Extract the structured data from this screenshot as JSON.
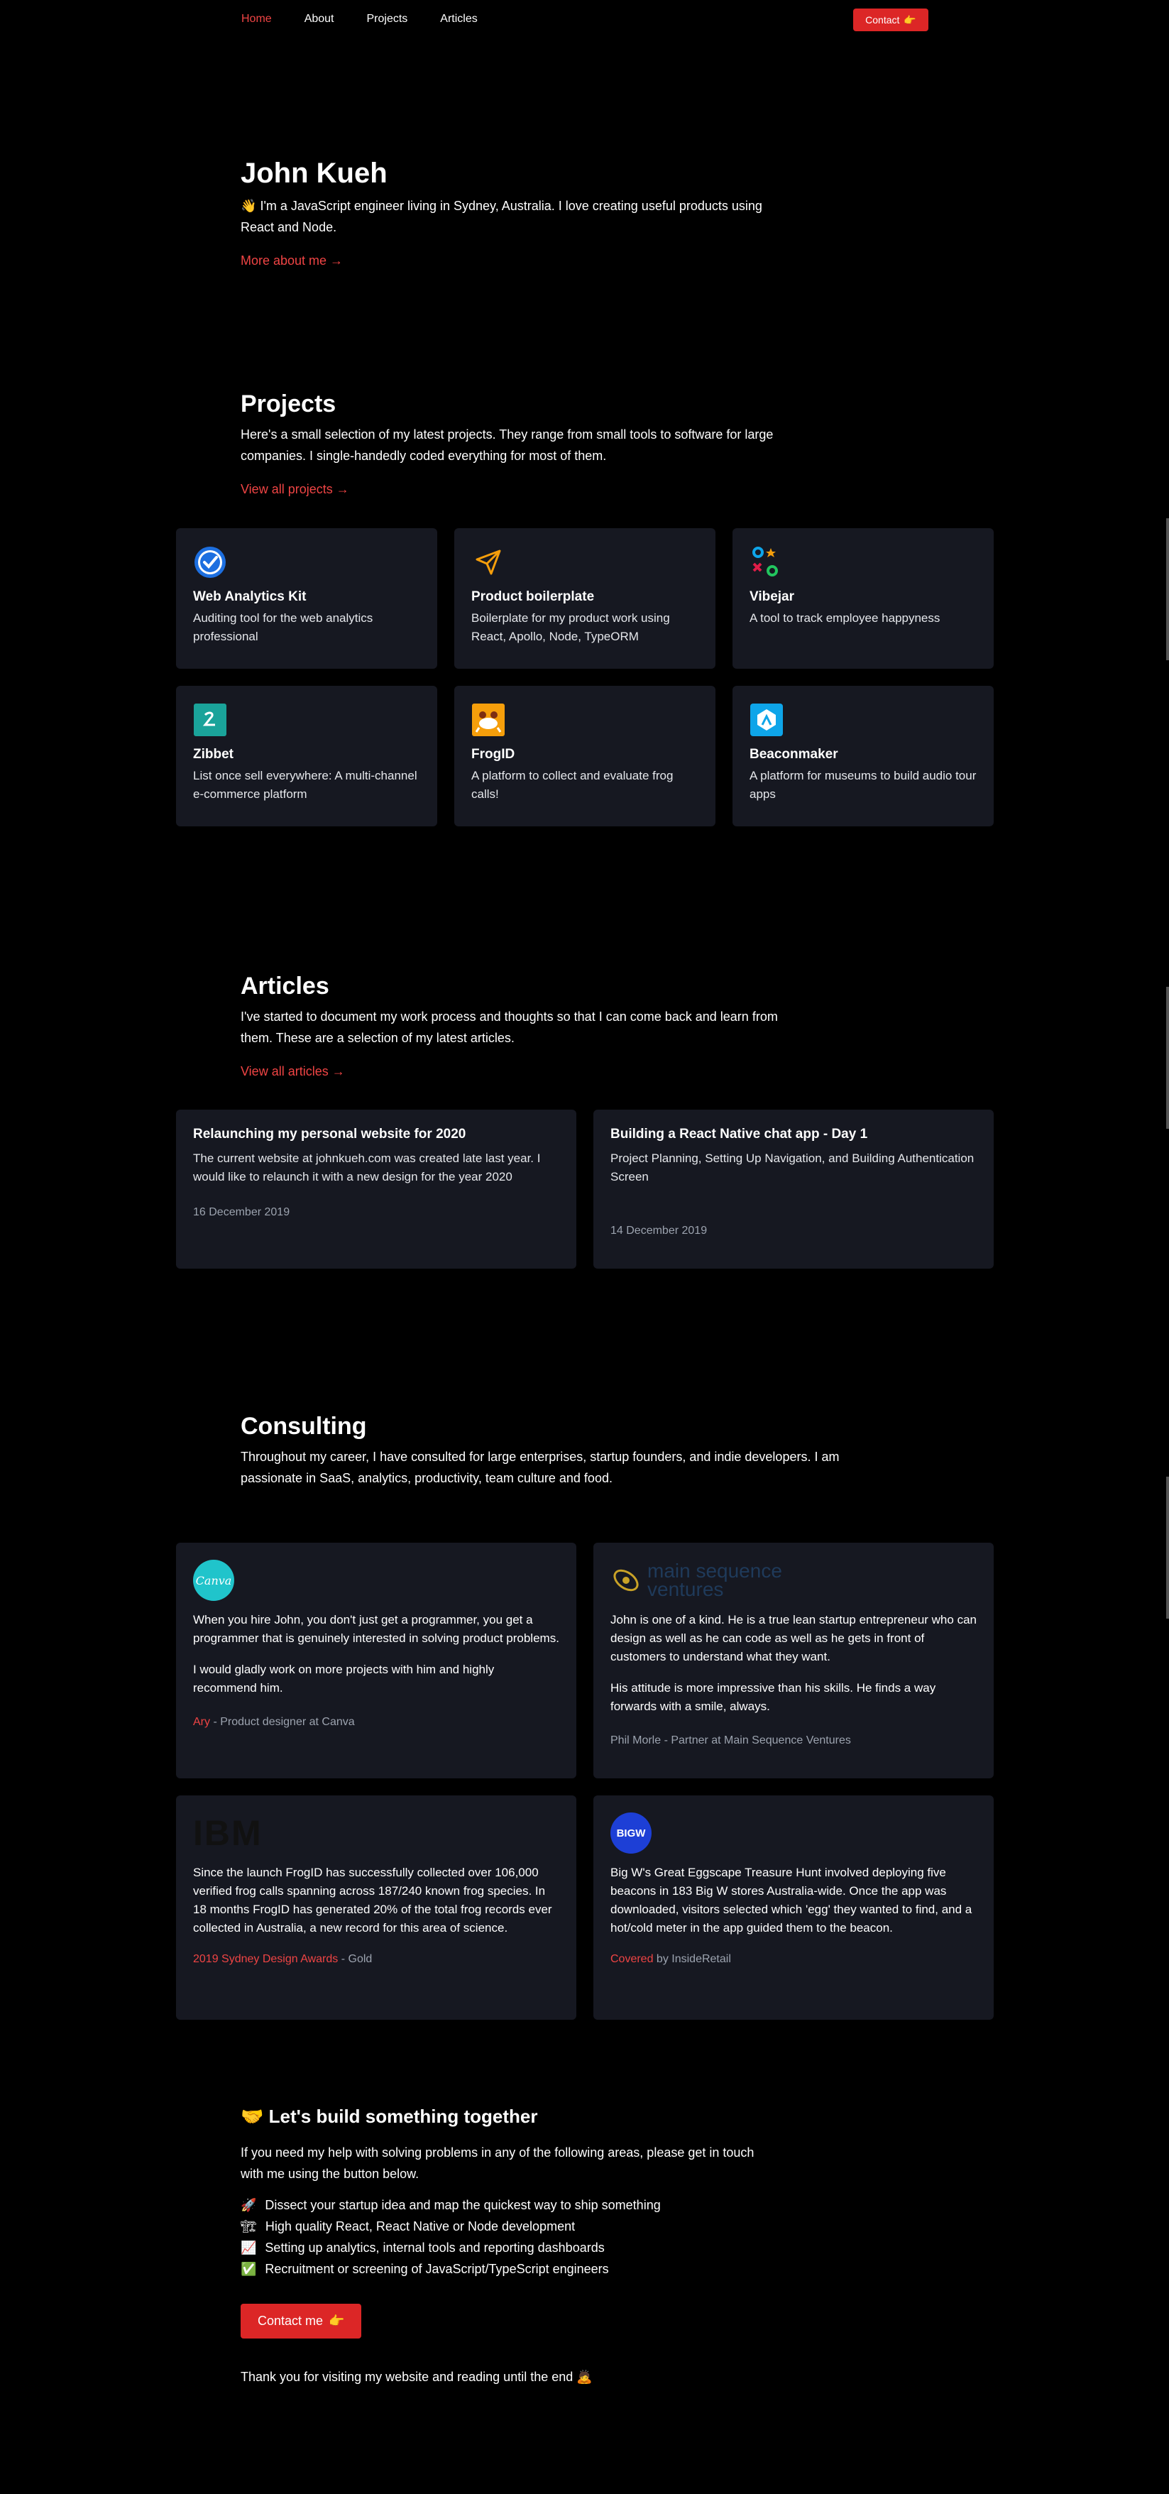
{
  "nav": {
    "items": [
      {
        "label": "Home",
        "active": true
      },
      {
        "label": "About"
      },
      {
        "label": "Projects"
      },
      {
        "label": "Articles"
      }
    ],
    "contact_label": "Contact",
    "contact_emoji": "👉"
  },
  "hero": {
    "title": "John Kueh",
    "emoji": "👋",
    "text": "I'm a JavaScript engineer living in Sydney, Australia. I love creating useful products using React and Node.",
    "link": "More about me →"
  },
  "projects": {
    "title": "Projects",
    "text": "Here's a small selection of my latest projects. They range from small tools to software for large companies. I single-handedly coded everything for most of them.",
    "link": "View all projects →",
    "items": [
      {
        "name": "Web Analytics Kit",
        "desc": "Auditing tool for the web analytics professional",
        "icon": "check-badge-icon"
      },
      {
        "name": "Product boilerplate",
        "desc": "Boilerplate for my product work using React, Apollo, Node, TypeORM",
        "icon": "paper-plane-icon"
      },
      {
        "name": "Vibejar",
        "desc": "A tool to track employee happyness",
        "icon": "shapes-icon"
      },
      {
        "name": "Zibbet",
        "desc": "List once sell everywhere: A multi-channel e-commerce platform",
        "icon": "zibbet-logo-icon"
      },
      {
        "name": "FrogID",
        "desc": "A platform to collect and evaluate frog calls!",
        "icon": "frog-icon"
      },
      {
        "name": "Beaconmaker",
        "desc": "A platform for museums to build audio tour apps",
        "icon": "beaconmaker-logo-icon"
      }
    ]
  },
  "articles": {
    "title": "Articles",
    "text": "I've started to document my work process and thoughts so that I can come back and learn from them. These are a selection of my latest articles.",
    "link": "View all articles →",
    "items": [
      {
        "title": "Relaunching my personal website for 2020",
        "desc": "The current website at johnkueh.com was created late last year. I would like to relaunch it with a new design for the year 2020",
        "date": "16 December 2019"
      },
      {
        "title": "Building a React Native chat app - Day 1",
        "desc": "Project Planning, Setting Up Navigation, and Building Authentication Screen",
        "date": "14 December 2019"
      }
    ]
  },
  "consulting": {
    "title": "Consulting",
    "text": "Throughout my career, I have consulted for large enterprises, startup founders, and indie developers. I am passionate in SaaS, analytics, productivity, team culture and food.",
    "items": [
      {
        "logo": "Canva",
        "paragraphs": [
          "When you hire John, you don't just get a programmer, you get a programmer that is genuinely interested in solving product problems.",
          "I would gladly work on more projects with him and highly recommend him."
        ],
        "attr_red": "Ary",
        "attr_rest": " - Product designer at Canva"
      },
      {
        "logo": "main sequence ventures",
        "paragraphs": [
          "John is one of a kind. He is a true lean startup entrepreneur who can design as well as he can code as well as he gets in front of customers to understand what they want.",
          "His attitude is more impressive than his skills. He finds a way forwards with a smile, always."
        ],
        "attr_red": "",
        "attr_rest": "Phil Morle - Partner at Main Sequence Ventures"
      },
      {
        "logo": "IBM",
        "paragraphs": [
          "Since the launch FrogID has successfully collected over 106,000 verified frog calls spanning across 187/240 known frog species. In 18 months FrogID has generated 20% of the total frog records ever collected in Australia, a new record for this area of science."
        ],
        "attr_red": "2019 Sydney Design Awards",
        "attr_rest": " - Gold"
      },
      {
        "logo": "BIGW",
        "paragraphs": [
          "Big W's Great Eggscape Treasure Hunt involved deploying five beacons in 183 Big W stores Australia-wide. Once the app was downloaded, visitors selected which 'egg' they wanted to find, and a hot/cold meter in the app guided them to the beacon."
        ],
        "attr_red": "Covered",
        "attr_rest": " by InsideRetail"
      }
    ]
  },
  "build": {
    "emoji": "🤝",
    "title": "Let's build something together",
    "text": "If you need my help with solving problems in any of the following areas, please get in touch with me using the button below.",
    "items": [
      {
        "emoji": "🚀",
        "text": "Dissect your startup idea and map the quickest way to ship something"
      },
      {
        "emoji": "🏗",
        "text": "High quality React, React Native or Node development"
      },
      {
        "emoji": "📈",
        "text": "Setting up analytics, internal tools and reporting dashboards"
      },
      {
        "emoji": "✅",
        "text": "Recruitment or screening of JavaScript/TypeScript engineers"
      }
    ],
    "button": "Contact me",
    "button_emoji": "👉",
    "footer": "Thank you for visiting my website and reading until the end",
    "footer_emoji": "🙇"
  }
}
